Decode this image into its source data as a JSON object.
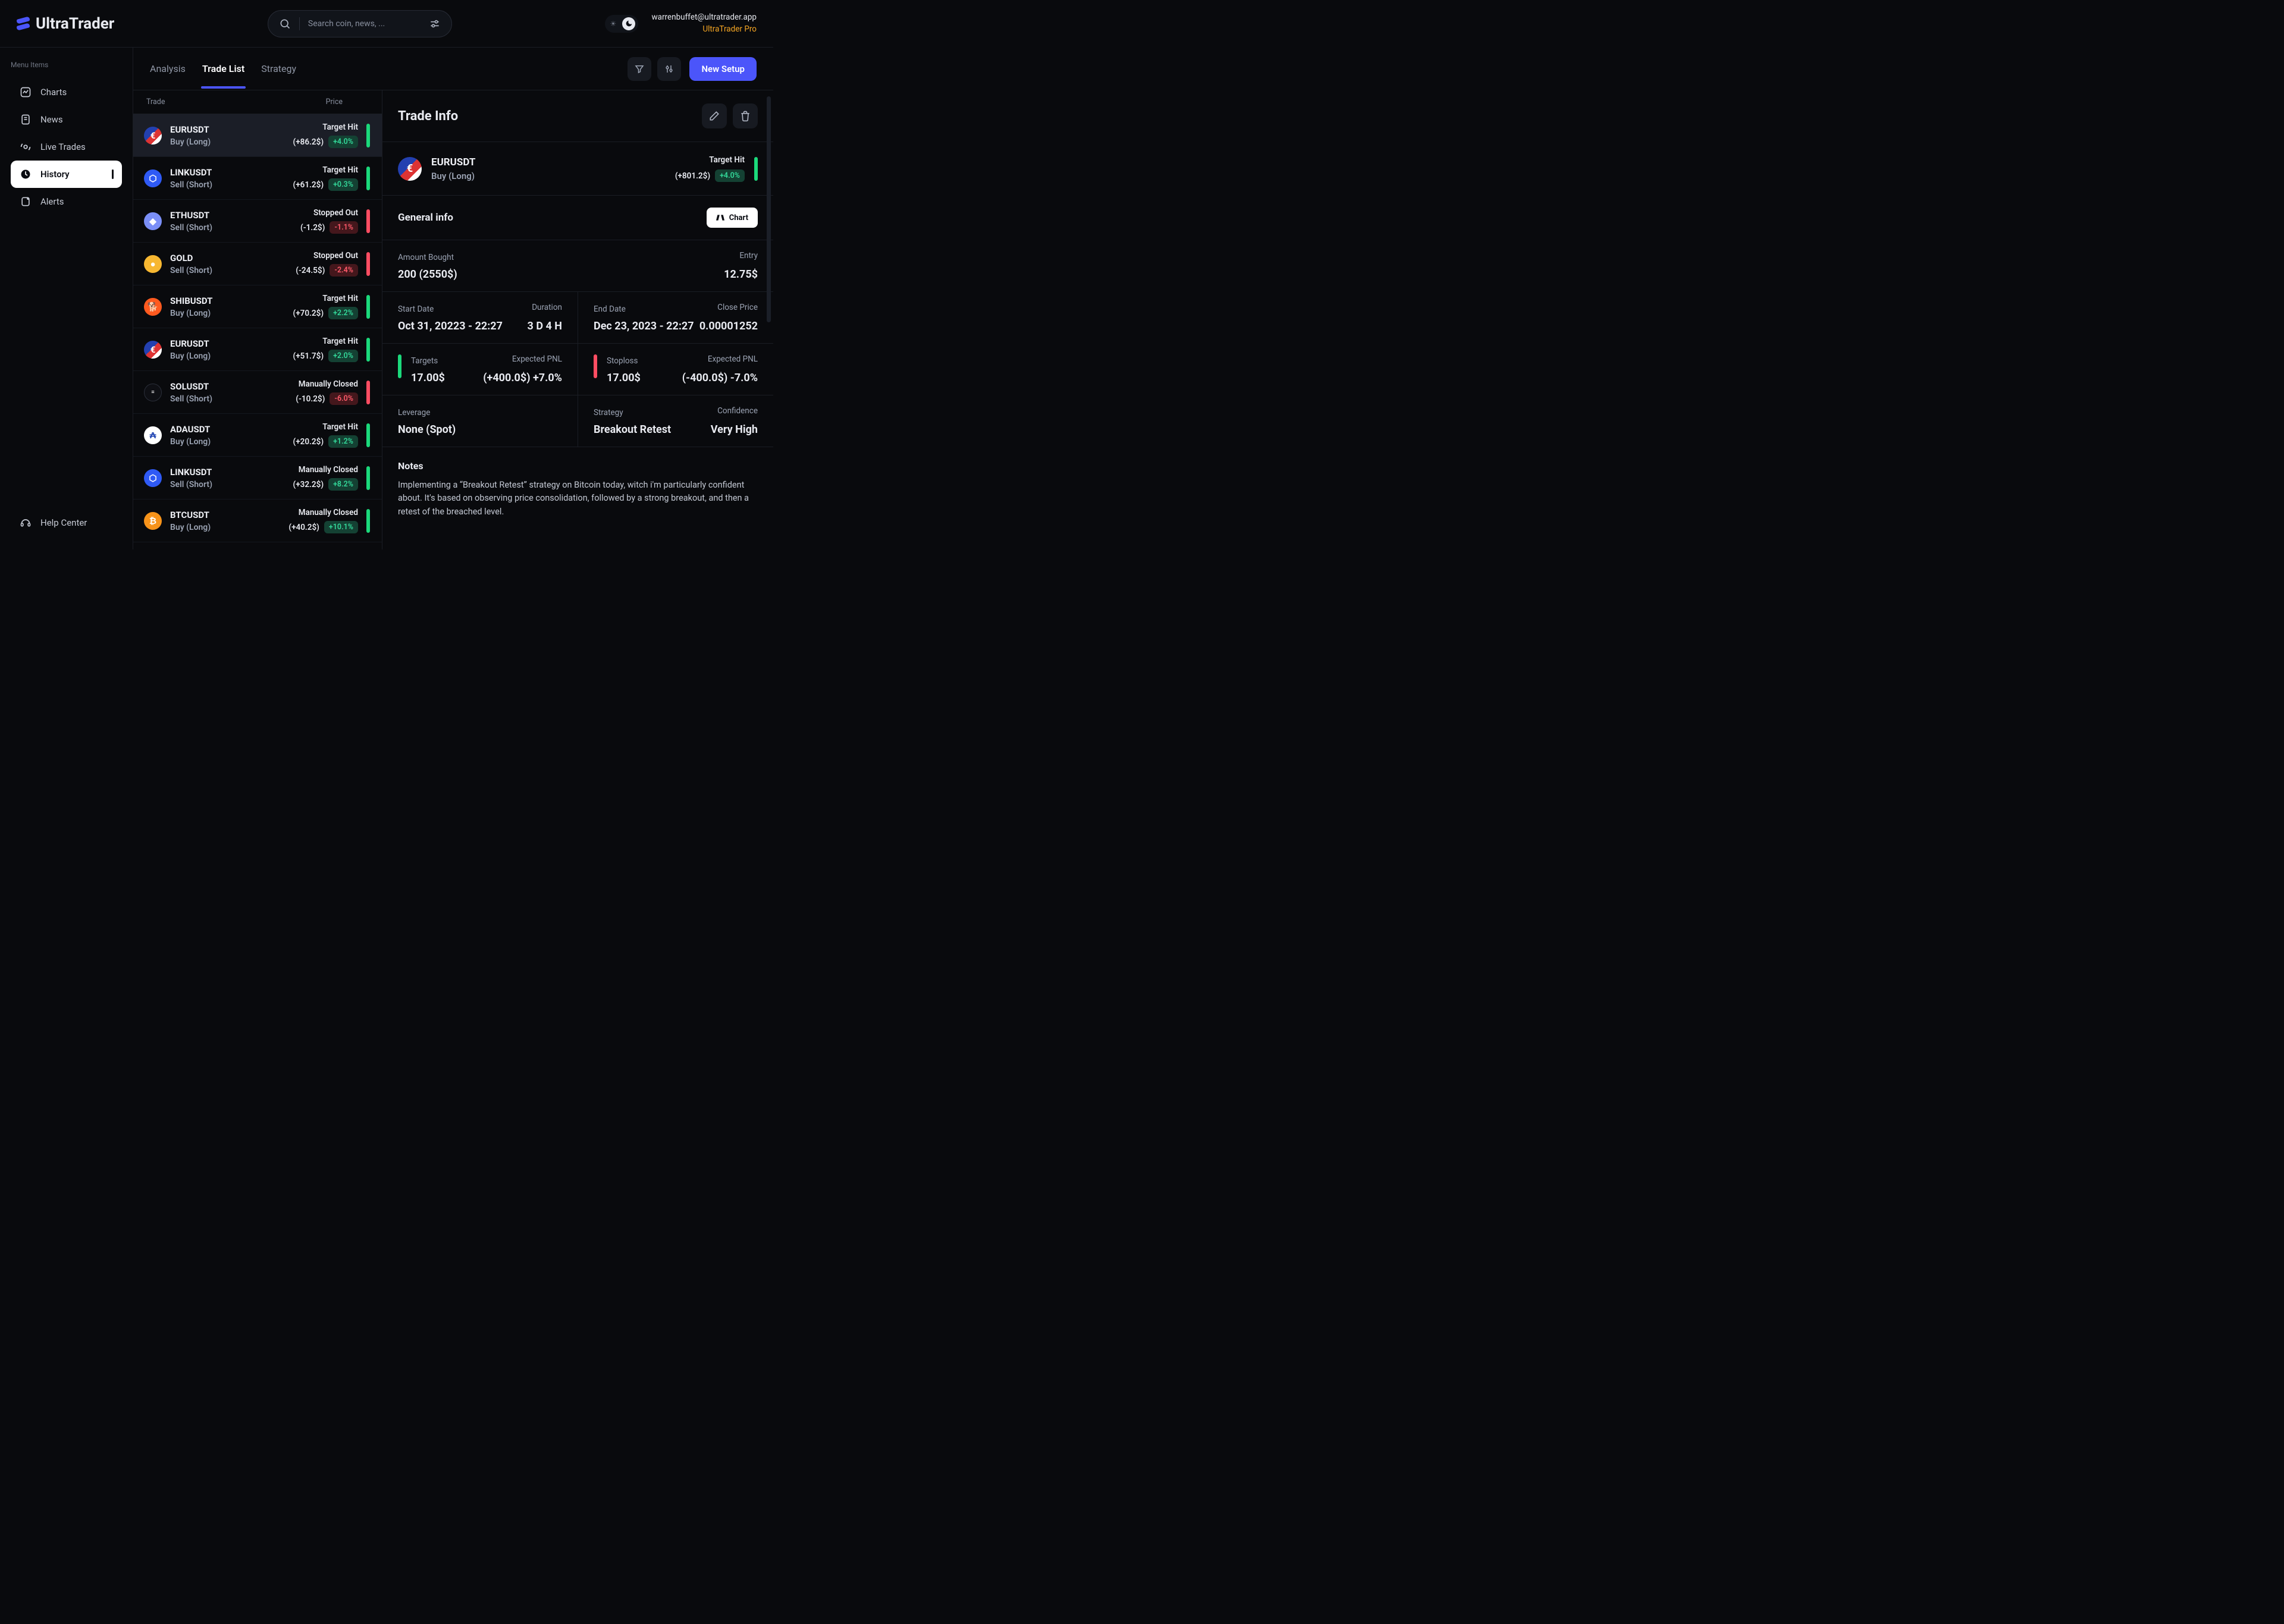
{
  "brand": "UltraTrader",
  "search": {
    "placeholder": "Search coin, news, ..."
  },
  "user": {
    "email": "warrenbuffet@ultratrader.app",
    "plan": "UltraTrader Pro"
  },
  "sidebar": {
    "menu_label": "Menu Items",
    "items": [
      {
        "label": "Charts"
      },
      {
        "label": "News"
      },
      {
        "label": "Live Trades"
      },
      {
        "label": "History"
      },
      {
        "label": "Alerts"
      }
    ],
    "help": "Help Center"
  },
  "tabs": [
    "Analysis",
    "Trade List",
    "Strategy"
  ],
  "primary_button": "New Setup",
  "list_header": {
    "left": "Trade",
    "right": "Price"
  },
  "trades": [
    {
      "symbol": "EURUSDT",
      "side": "Buy (Long)",
      "status": "Target Hit",
      "dollar": "(+86.2$)",
      "pct": "+4.0%",
      "green": true,
      "cls": "c-eur",
      "glyph": "€"
    },
    {
      "symbol": "LINKUSDT",
      "side": "Sell (Short)",
      "status": "Target Hit",
      "dollar": "(+61.2$)",
      "pct": "+0.3%",
      "green": true,
      "cls": "c-link",
      "glyph": "⬡"
    },
    {
      "symbol": "ETHUSDT",
      "side": "Sell (Short)",
      "status": "Stopped Out",
      "dollar": "(-1.2$)",
      "pct": "-1.1%",
      "green": false,
      "cls": "c-eth",
      "glyph": "◆"
    },
    {
      "symbol": "GOLD",
      "side": "Sell (Short)",
      "status": "Stopped Out",
      "dollar": "(-24.5$)",
      "pct": "-2.4%",
      "green": false,
      "cls": "c-gold",
      "glyph": "●"
    },
    {
      "symbol": "SHIBUSDT",
      "side": "Buy (Long)",
      "status": "Target Hit",
      "dollar": "(+70.2$)",
      "pct": "+2.2%",
      "green": true,
      "cls": "c-shib",
      "glyph": "🐕"
    },
    {
      "symbol": "EURUSDT",
      "side": "Buy (Long)",
      "status": "Target Hit",
      "dollar": "(+51.7$)",
      "pct": "+2.0%",
      "green": true,
      "cls": "c-eur",
      "glyph": "€"
    },
    {
      "symbol": "SOLUSDT",
      "side": "Sell (Short)",
      "status": "Manually Closed",
      "dollar": "(-10.2$)",
      "pct": "-6.0%",
      "green": false,
      "cls": "c-sol",
      "glyph": "≡"
    },
    {
      "symbol": "ADAUSDT",
      "side": "Buy (Long)",
      "status": "Target Hit",
      "dollar": "(+20.2$)",
      "pct": "+1.2%",
      "green": true,
      "cls": "c-ada",
      "glyph": "₳"
    },
    {
      "symbol": "LINKUSDT",
      "side": "Sell (Short)",
      "status": "Manually Closed",
      "dollar": "(+32.2$)",
      "pct": "+8.2%",
      "green": true,
      "cls": "c-link",
      "glyph": "⬡"
    },
    {
      "symbol": "BTCUSDT",
      "side": "Buy (Long)",
      "status": "Manually Closed",
      "dollar": "(+40.2$)",
      "pct": "+10.1%",
      "green": true,
      "cls": "c-btc",
      "glyph": "₿"
    }
  ],
  "detail": {
    "title": "Trade Info",
    "symbol": "EURUSDT",
    "side": "Buy (Long)",
    "status": "Target Hit",
    "dollar": "(+801.2$)",
    "pct": "+4.0%",
    "general_heading": "General info",
    "chart_button": "Chart",
    "amount_label": "Amount Bought",
    "amount_value": "200 (2550$)",
    "entry_label": "Entry",
    "entry_value": "12.75$",
    "start_label": "Start Date",
    "start_value": "Oct 31, 20223 - 22:27",
    "duration_label": "Duration",
    "duration_value": "3 D 4 H",
    "end_label": "End Date",
    "end_value": "Dec 23, 2023 - 22:27",
    "close_label": "Close Price",
    "close_value": "0.00001252",
    "targets_label": "Targets",
    "targets_value": "17.00$",
    "targets_pnl_label": "Expected PNL",
    "targets_pnl_value": "(+400.0$) +7.0%",
    "stop_label": "Stoploss",
    "stop_value": "17.00$",
    "stop_pnl_label": "Expected PNL",
    "stop_pnl_value": "(-400.0$) -7.0%",
    "leverage_label": "Leverage",
    "leverage_value": "None (Spot)",
    "strategy_label": "Strategy",
    "strategy_value": "Breakout Retest",
    "confidence_label": "Confidence",
    "confidence_value": "Very High",
    "notes_heading": "Notes",
    "notes_body": "Implementing a “Breakout Retest” strategy on Bitcoin today, witch i'm particularly confident about. It's based on observing price consolidation, followed by a strong breakout, and then a retest of the breached level."
  }
}
